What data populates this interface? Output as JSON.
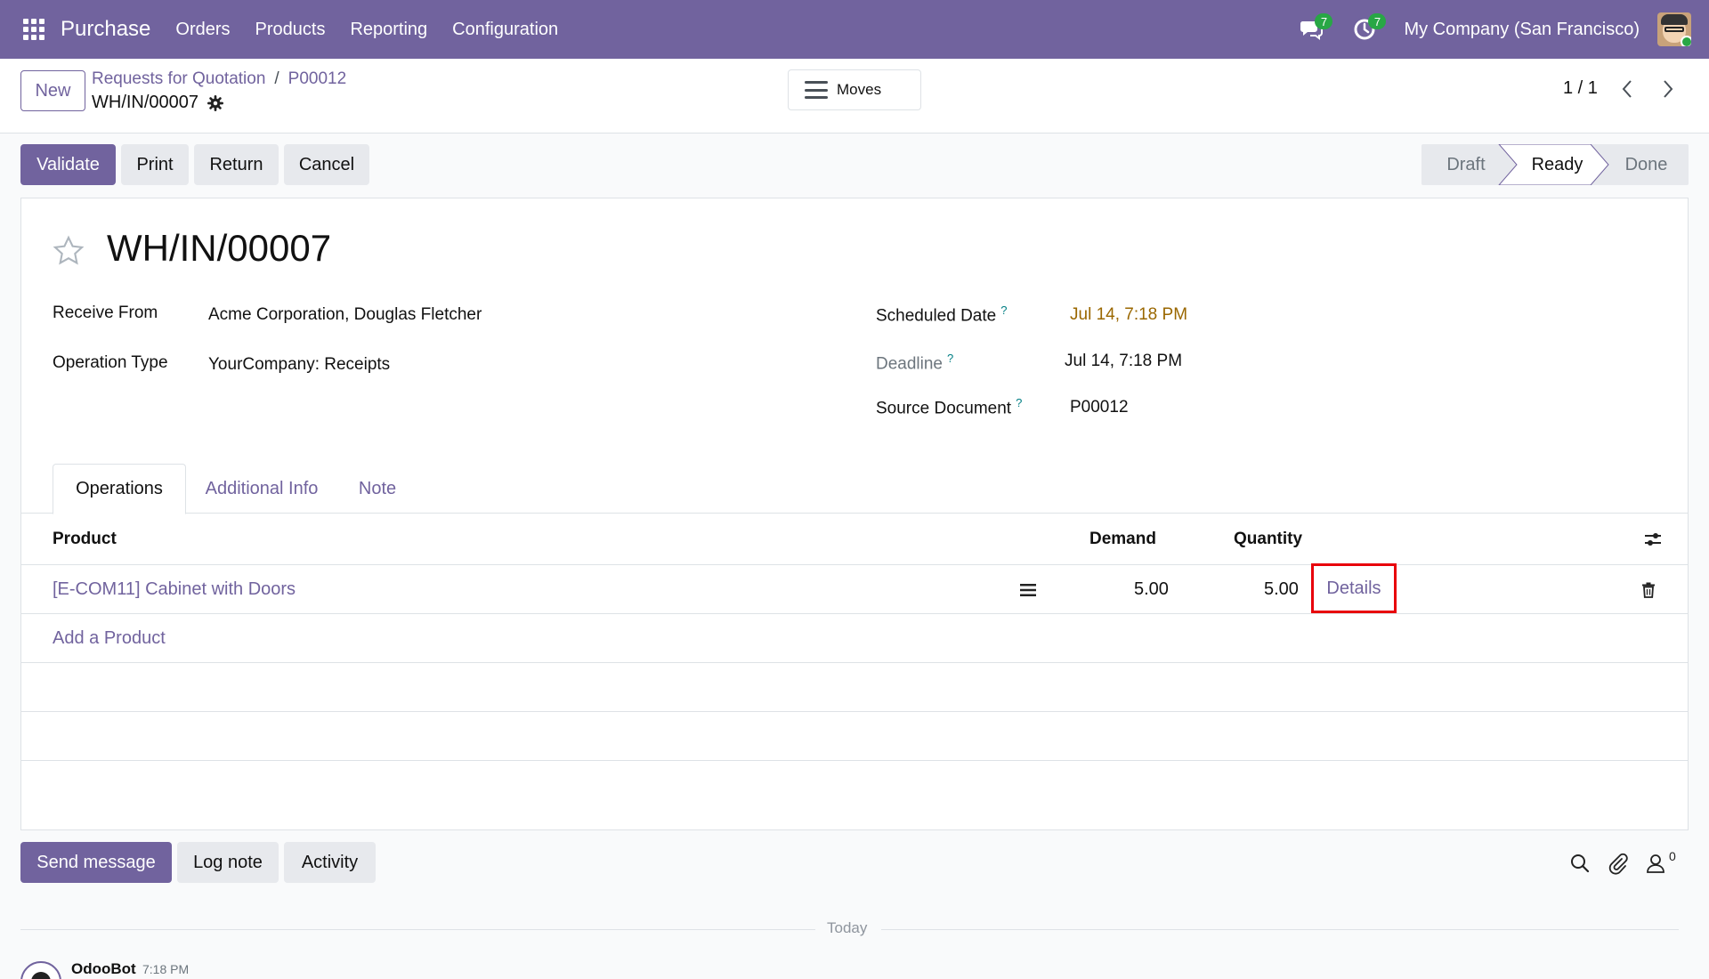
{
  "navbar": {
    "brand": "Purchase",
    "menu": [
      "Orders",
      "Products",
      "Reporting",
      "Configuration"
    ],
    "messages_count": "7",
    "activities_count": "7",
    "company": "My Company (San Francisco)"
  },
  "control": {
    "new_label": "New",
    "breadcrumb": [
      "Requests for Quotation",
      "P00012"
    ],
    "breadcrumb_sep": "/",
    "record": "WH/IN/00007",
    "moves_label": "Moves",
    "pager": "1 / 1"
  },
  "actions": {
    "validate": "Validate",
    "print": "Print",
    "return": "Return",
    "cancel": "Cancel"
  },
  "stages": [
    "Draft",
    "Ready",
    "Done"
  ],
  "stage_current": "Ready",
  "form": {
    "title": "WH/IN/00007",
    "receive_from_label": "Receive From",
    "receive_from": "Acme Corporation, Douglas Fletcher",
    "operation_type_label": "Operation Type",
    "operation_type": "YourCompany: Receipts",
    "scheduled_date_label": "Scheduled Date",
    "scheduled_date": "Jul 14, 7:18 PM",
    "deadline_label": "Deadline",
    "deadline": "Jul 14, 7:18 PM",
    "source_document_label": "Source Document",
    "source_document": "P00012",
    "help_mark": "?"
  },
  "tabs": [
    "Operations",
    "Additional Info",
    "Note"
  ],
  "table": {
    "headers": {
      "product": "Product",
      "demand": "Demand",
      "quantity": "Quantity"
    },
    "rows": [
      {
        "product": "[E-COM11] Cabinet with Doors",
        "demand": "5.00",
        "quantity": "5.00",
        "details": "Details"
      }
    ],
    "add_product": "Add a Product"
  },
  "chatter": {
    "send_message": "Send message",
    "log_note": "Log note",
    "activity": "Activity",
    "followers_count": "0",
    "today": "Today",
    "author": "OdooBot",
    "time": "7:18 PM"
  },
  "colors": {
    "brand": "#71639e",
    "highlight": "#e8000b",
    "warning_date": "#9a6700",
    "badge": "#28a745"
  }
}
